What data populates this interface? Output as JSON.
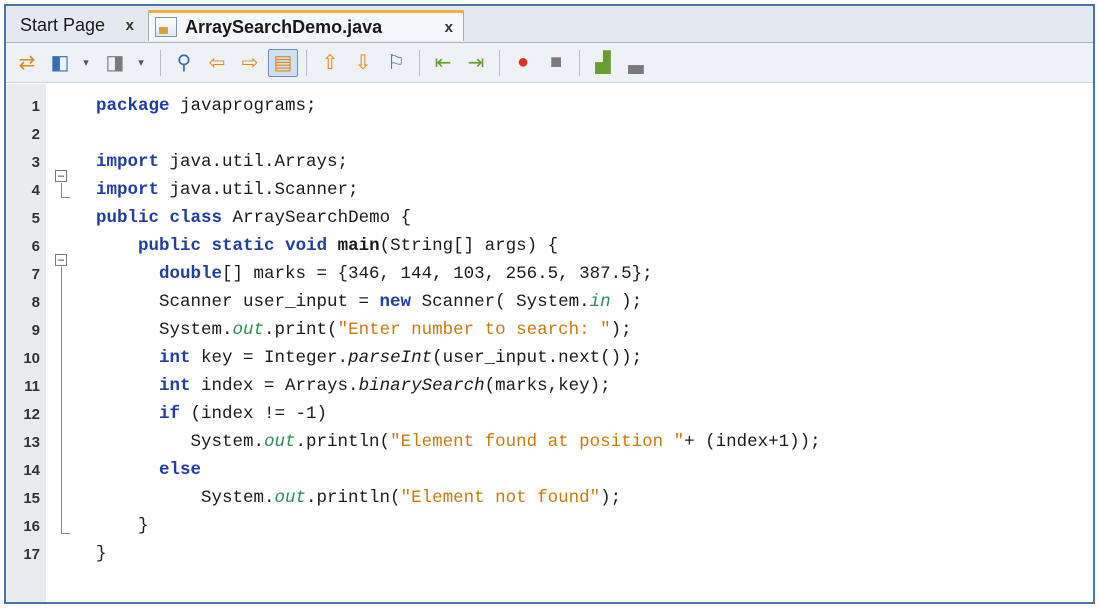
{
  "tabs": [
    {
      "label": "Start Page",
      "close": "x",
      "active": false
    },
    {
      "label": "ArraySearchDemo.java",
      "close": "x",
      "active": true
    }
  ],
  "toolbar": {
    "icons": [
      "source-history-icon",
      "back-icon",
      "dropdown-icon",
      "forward-icon",
      "dropdown-icon",
      "find-icon",
      "find-previous-icon",
      "find-next-icon",
      "toggle-highlight-icon",
      "previous-bookmark-icon",
      "next-bookmark-icon",
      "toggle-bookmark-icon",
      "shift-left-icon",
      "shift-right-icon",
      "start-macro-icon",
      "stop-macro-icon",
      "comment-icon",
      "uncomment-icon"
    ],
    "accent": "#3a6fb0"
  },
  "editor": {
    "lines": [
      {
        "n": "1",
        "text": "package javaprograms;"
      },
      {
        "n": "2",
        "text": ""
      },
      {
        "n": "3",
        "text": "import java.util.Arrays;"
      },
      {
        "n": "4",
        "text": "import java.util.Scanner;"
      },
      {
        "n": "5",
        "text": "public class ArraySearchDemo {"
      },
      {
        "n": "6",
        "text": "    public static void main(String[] args) {"
      },
      {
        "n": "7",
        "text": "      double[] marks = {346, 144, 103, 256.5, 387.5};"
      },
      {
        "n": "8",
        "text": "      Scanner user_input = new Scanner( System.in );"
      },
      {
        "n": "9",
        "text": "      System.out.print(\"Enter number to search: \");"
      },
      {
        "n": "10",
        "text": "      int key = Integer.parseInt(user_input.next());"
      },
      {
        "n": "11",
        "text": "      int index = Arrays.binarySearch(marks,key);"
      },
      {
        "n": "12",
        "text": "      if (index != -1)"
      },
      {
        "n": "13",
        "text": "         System.out.println(\"Element found at position \"+ (index+1));"
      },
      {
        "n": "14",
        "text": "      else"
      },
      {
        "n": "15",
        "text": "          System.out.println(\"Element not found\");"
      },
      {
        "n": "16",
        "text": "    }"
      },
      {
        "n": "17",
        "text": "}"
      }
    ]
  }
}
